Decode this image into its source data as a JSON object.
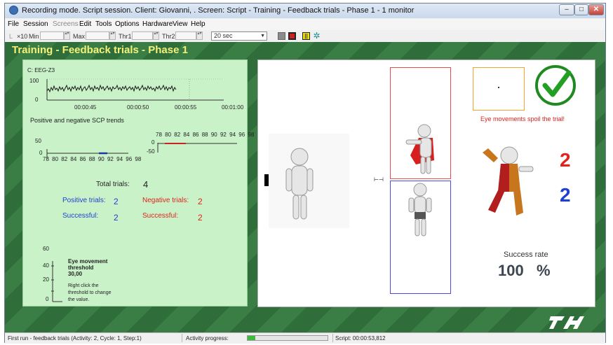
{
  "window": {
    "title": "Recording mode. Script session. Client: Giovanni, . Screen: Script - Training - Feedback trials - Phase 1 - 1 monitor"
  },
  "menu": [
    "File",
    "Session",
    "Screens",
    "Edit",
    "Tools",
    "Options",
    "Hardware",
    "View",
    "Help"
  ],
  "toolbar": {
    "x10": "×10",
    "min_label": "Min",
    "max_label": "Max",
    "thr1_label": "Thr1",
    "thr2_label": "Thr2",
    "duration": "20 sec"
  },
  "screen_title": "Training - Feedback trials - Phase 1",
  "eeg": {
    "channel": "C: EEG-Z3",
    "y_ticks": [
      "100",
      "0"
    ],
    "x_ticks": [
      "00:00:45",
      "00:00:50",
      "00:00:55",
      "00:01:00"
    ]
  },
  "trends": {
    "title": "Positive and negative SCP trends",
    "pos_y_ticks": [
      "50",
      "0"
    ],
    "neg_y_ticks": [
      "0",
      "-50"
    ],
    "x_ticks": [
      "78",
      "80",
      "82",
      "84",
      "86",
      "88",
      "90",
      "92",
      "94",
      "96",
      "98"
    ]
  },
  "totals": {
    "total_label": "Total trials:",
    "total_value": "4",
    "positive_label": "Positive trials:",
    "positive_value": "2",
    "negative_label": "Negative trials:",
    "negative_value": "2",
    "pos_success_label": "Successful:",
    "pos_success_value": "2",
    "neg_success_label": "Successful:",
    "neg_success_value": "2"
  },
  "eye": {
    "ticks": [
      "60",
      "40",
      "20",
      "0"
    ],
    "title_line1": "Eye movement",
    "title_line2": "threshold",
    "value": "30,00",
    "hint_line1": "Right click the",
    "hint_line2": "threshold to change",
    "hint_line3": "the value."
  },
  "feedback": {
    "eye_warning": "Eye movements spoil the trial!",
    "score_red": "2",
    "score_blue": "2",
    "success_label": "Success rate",
    "success_value": "100",
    "success_unit": "%"
  },
  "status": {
    "run": "First run - feedback trials (Activity: 2, Cycle: 1, Step:1)",
    "progress_label": "Activity progress:",
    "progress_fraction": 0.1,
    "script_time": "Script: 00:00:53,812"
  },
  "colors": {
    "stage_green": "#2f6e3a",
    "title_yellow": "#f3f17a",
    "panel_green": "#c9f2c9",
    "positive_blue": "#1f3fd1",
    "negative_red": "#e0231c"
  },
  "icons": [
    "app-icon",
    "checkmark-icon",
    "logo-icon"
  ]
}
